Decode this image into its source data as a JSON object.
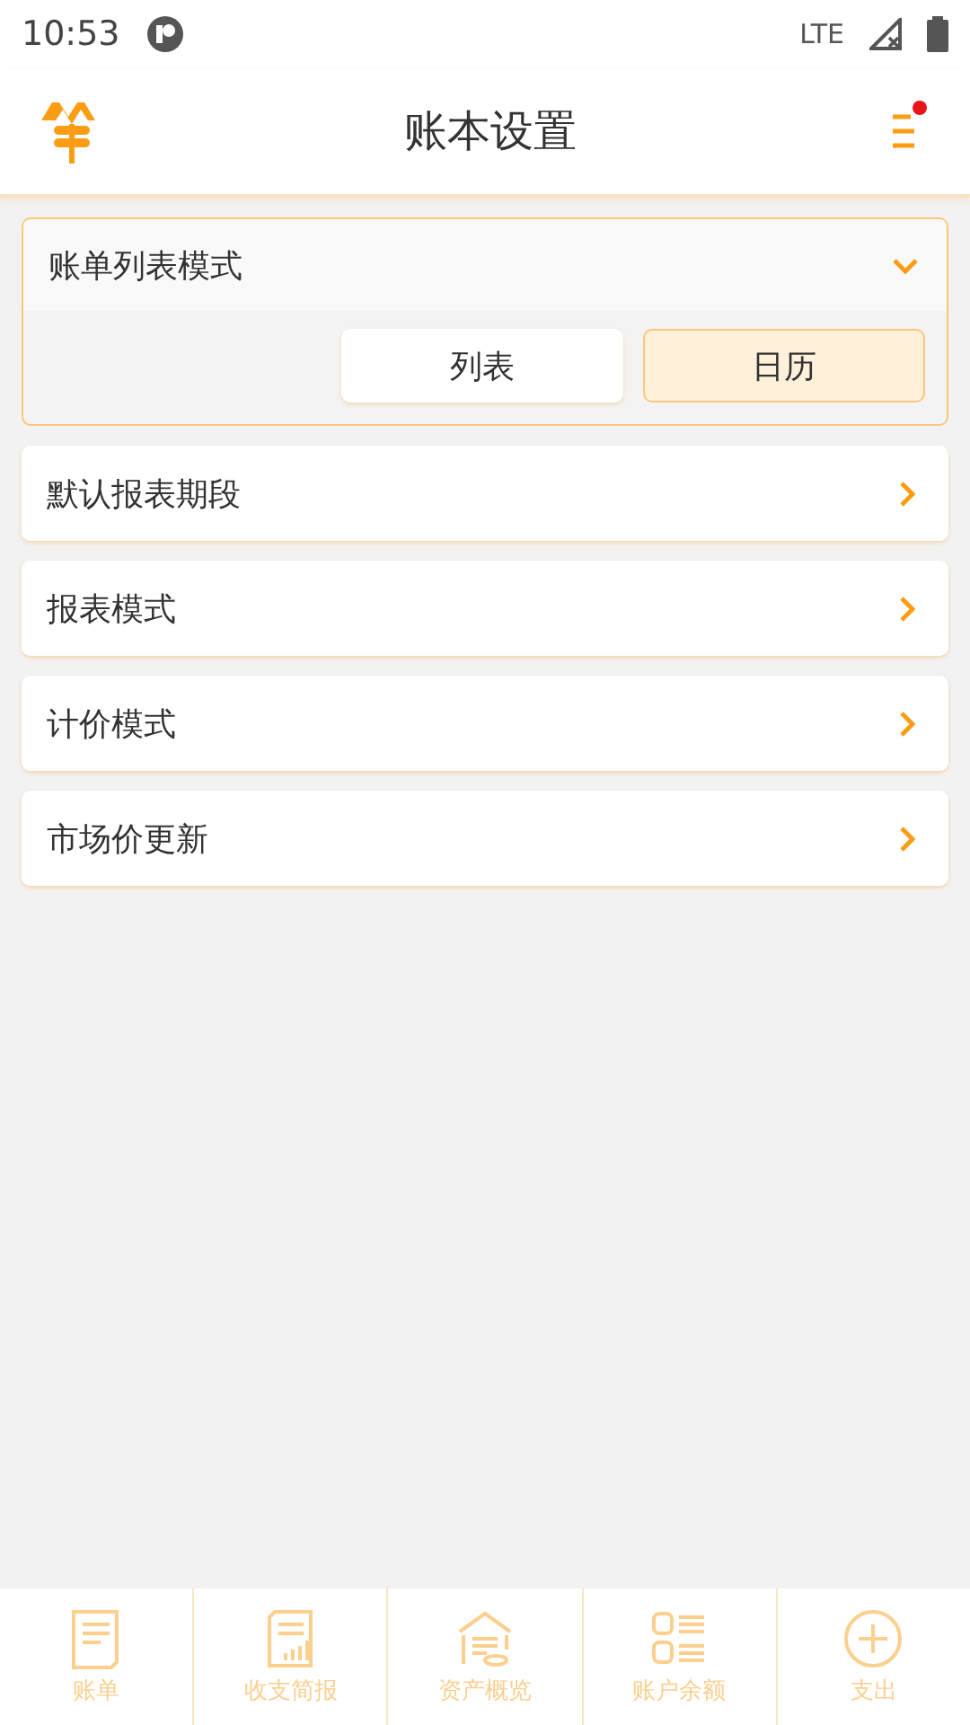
{
  "status_bar": {
    "time": "10:53",
    "network": "LTE"
  },
  "header": {
    "title": "账本设置",
    "has_notification": true
  },
  "sections": [
    {
      "label": "账单列表模式",
      "expanded": true,
      "options": [
        {
          "label": "列表",
          "selected": false
        },
        {
          "label": "日历",
          "selected": true
        }
      ]
    },
    {
      "label": "默认报表期段",
      "expanded": false
    },
    {
      "label": "报表模式",
      "expanded": false
    },
    {
      "label": "计价模式",
      "expanded": false
    },
    {
      "label": "市场价更新",
      "expanded": false
    }
  ],
  "tab_bar": [
    {
      "label": "账单",
      "kind": "bill"
    },
    {
      "label": "收支简报",
      "kind": "report"
    },
    {
      "label": "资产概览",
      "kind": "assets"
    },
    {
      "label": "账户余额",
      "kind": "balance"
    },
    {
      "label": "支出",
      "kind": "add"
    }
  ]
}
